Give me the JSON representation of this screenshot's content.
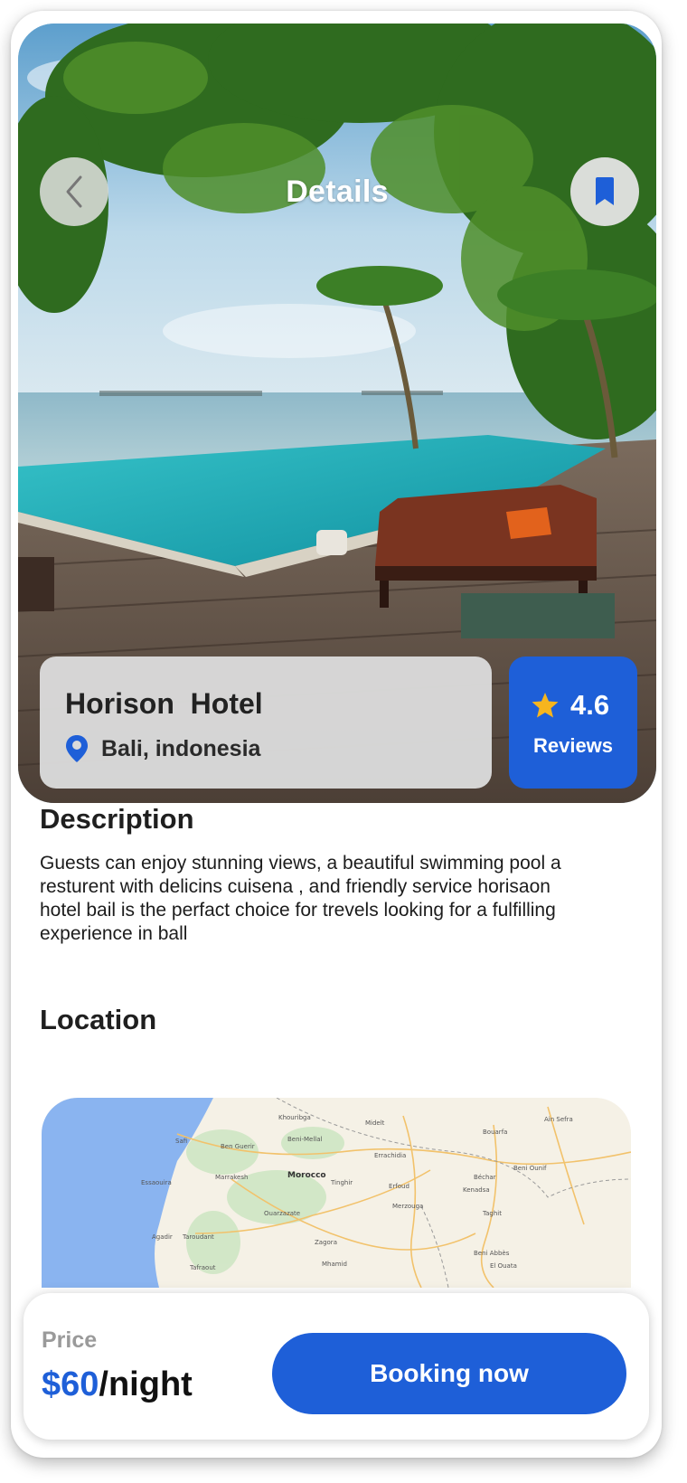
{
  "header": {
    "title": "Details",
    "back_icon": "chevron-left-icon",
    "bookmark_icon": "bookmark-icon"
  },
  "hotel": {
    "name": "Horison  Hotel",
    "location": "Bali, indonesia",
    "location_icon": "map-pin-icon",
    "rating": "4.6",
    "rating_label": "Reviews",
    "rating_icon": "star-icon"
  },
  "description": {
    "title": "Description",
    "text": "Guests can enjoy stunning views, a beautiful swimming pool a resturent with delicins cuisena , and friendly service horisaon hotel bail is the perfact choice for trevels looking for a fulfilling experience in ball"
  },
  "location_section": {
    "title": "Location",
    "map_labels": [
      "Safi",
      "Marrakesh",
      "Morocco",
      "Essaouira",
      "Agadir",
      "Taroudant",
      "Ouarzazate",
      "Errachidia",
      "Béchar",
      "Zagora",
      "Tinghir",
      "Midelt",
      "Beni-Mellal",
      "Khouribga",
      "Ben Guerir",
      "Bouarfa",
      "Erfoud",
      "Merzouga",
      "Taghit",
      "Beni Abbès",
      "El Ouata",
      "Ain Sefra",
      "Beni Ounif",
      "Kenadsa",
      "Mhamid",
      "Tafraout"
    ]
  },
  "booking": {
    "price_label": "Price",
    "price_amount": "$60",
    "price_unit": "/night",
    "button_label": "Booking now"
  },
  "colors": {
    "accent": "#1e5fd8",
    "star": "#f6b51e",
    "text_dark": "#1f1f1f",
    "text_muted": "#9a9a9a"
  }
}
